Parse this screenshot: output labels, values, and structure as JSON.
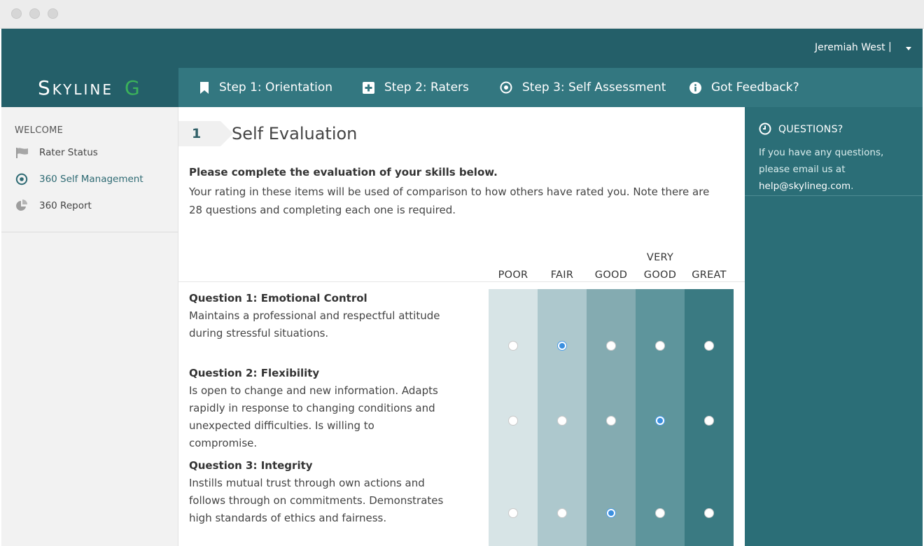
{
  "window": {
    "controls": [
      "close",
      "minimize",
      "maximize"
    ]
  },
  "header": {
    "user_name": "Jeremiah West",
    "separator": "|",
    "logo_text": "Skyline",
    "logo_mark": "G"
  },
  "nav": {
    "items": [
      {
        "label": "Step 1: Orientation",
        "icon": "bookmark-icon"
      },
      {
        "label": "Step 2: Raters",
        "icon": "plus-square-icon"
      },
      {
        "label": "Step 3: Self Assessment",
        "icon": "target-icon"
      },
      {
        "label": "Got Feedback?",
        "icon": "info-icon"
      }
    ]
  },
  "sidebar": {
    "heading": "WELCOME",
    "items": [
      {
        "label": "Rater Status",
        "icon": "flag-icon",
        "active": false
      },
      {
        "label": "360 Self Management",
        "icon": "target-icon",
        "active": true
      },
      {
        "label": "360 Report",
        "icon": "pie-chart-icon",
        "active": false
      }
    ]
  },
  "main": {
    "step_number": "1",
    "title": "Self Evaluation",
    "intro_bold": "Please complete the evaluation of your skills below.",
    "intro_text": "Your rating in these items will be used of comparison to how others have rated you. Note there are 28 questions and completing each one is required.",
    "rating_columns": [
      {
        "line1": "",
        "line2": "POOR",
        "color": "#d7e4e6"
      },
      {
        "line1": "",
        "line2": "FAIR",
        "color": "#adc8cd"
      },
      {
        "line1": "",
        "line2": "GOOD",
        "color": "#84abb1"
      },
      {
        "line1": "VERY",
        "line2": "GOOD",
        "color": "#5e959c"
      },
      {
        "line1": "",
        "line2": "GREAT",
        "color": "#3a7a82"
      }
    ],
    "questions": [
      {
        "title": "Question 1: Emotional Control",
        "description": "Maintains a professional and respectful attitude during stressful situations.",
        "selected": 1
      },
      {
        "title": "Question 2: Flexibility",
        "description": "Is open to change and new information. Adapts rapidly in response to changing conditions and unexpected difficulties. Is willing to compromise.",
        "selected": 3
      },
      {
        "title": "Question 3: Integrity",
        "description": "Instills mutual trust through own actions and follows through on commitments. Demonstrates high standards of ethics and fairness.",
        "selected": 2
      }
    ]
  },
  "questions_panel": {
    "title": "QUESTIONS?",
    "text": "If you have any questions, please email us at ",
    "email": "help@skylineg.com",
    "text_end": "."
  },
  "colors": {
    "topbar": "#245f69",
    "navbar": "#337780",
    "panel": "#2b6e77",
    "logo_accent": "#3bb25a",
    "radio_selected": "#3a8fe0"
  }
}
